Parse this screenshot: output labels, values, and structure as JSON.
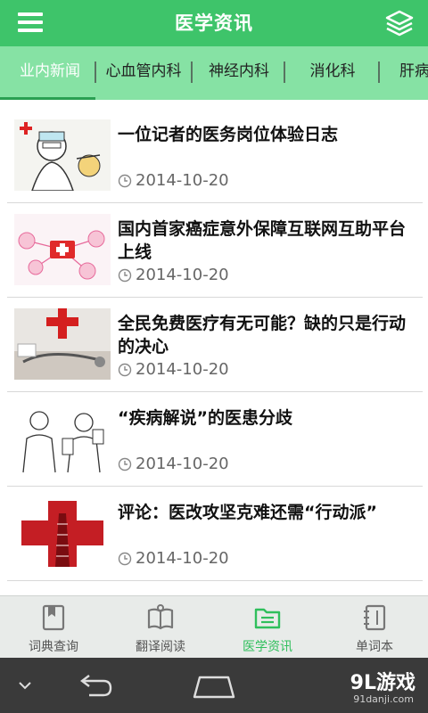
{
  "header": {
    "title": "医学资讯"
  },
  "tabs": [
    {
      "label": "业内新闻"
    },
    {
      "label": "心血管内科"
    },
    {
      "label": "神经内科"
    },
    {
      "label": "消化科"
    },
    {
      "label": "肝病"
    }
  ],
  "articles": [
    {
      "title": "一位记者的医务岗位体验日志",
      "date": "2014-10-20"
    },
    {
      "title": "国内首家癌症意外保障互联网互助平台上线",
      "date": "2014-10-20"
    },
    {
      "title": "全民免费医疗有无可能？缺的只是行动的决心",
      "date": "2014-10-20"
    },
    {
      "title": "“疾病解说”的医患分歧",
      "date": "2014-10-20"
    },
    {
      "title": "评论：医改攻坚克难还需“行动派”",
      "date": "2014-10-20"
    }
  ],
  "bottom_nav": [
    {
      "label": "词典查询",
      "icon": "bookmark-book-icon"
    },
    {
      "label": "翻译阅读",
      "icon": "open-book-icon"
    },
    {
      "label": "医学资讯",
      "icon": "folder-news-icon"
    },
    {
      "label": "单词本",
      "icon": "notebook-icon"
    }
  ],
  "watermark": {
    "logo": "9L游戏",
    "site": "91danji.com"
  },
  "colors": {
    "header": "#3ec46a",
    "tabs": "#86e2a4",
    "active_nav": "#2fbf5c"
  }
}
